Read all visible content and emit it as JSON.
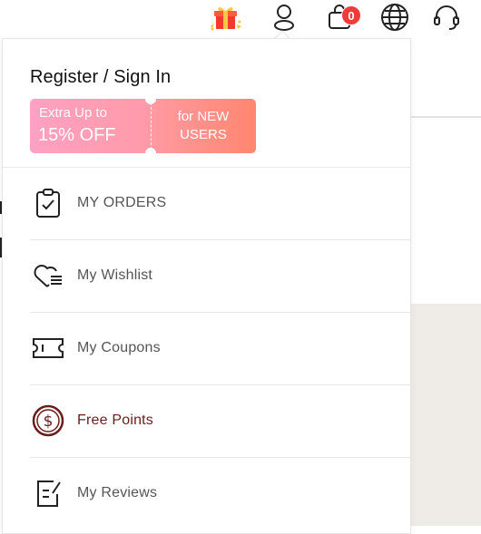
{
  "topbar": {
    "icons": [
      "gift-icon",
      "user-icon",
      "cart-icon",
      "globe-icon",
      "headset-icon"
    ],
    "cart_count": "0",
    "badge_color": "#f23a3a"
  },
  "account_menu": {
    "title": "Register / Sign In",
    "promo": {
      "line1": "Extra Up to",
      "line2": "15% OFF",
      "right_line1": "for NEW",
      "right_line2": "USERS"
    },
    "items": [
      {
        "label": "MY ORDERS",
        "icon": "clipboard-check-icon"
      },
      {
        "label": "My Wishlist",
        "icon": "heart-list-icon"
      },
      {
        "label": "My Coupons",
        "icon": "ticket-icon"
      },
      {
        "label": "Free Points",
        "icon": "dollar-coin-icon"
      },
      {
        "label": "My Reviews",
        "icon": "edit-document-icon"
      }
    ],
    "accent_color": "#6a1d1d"
  }
}
